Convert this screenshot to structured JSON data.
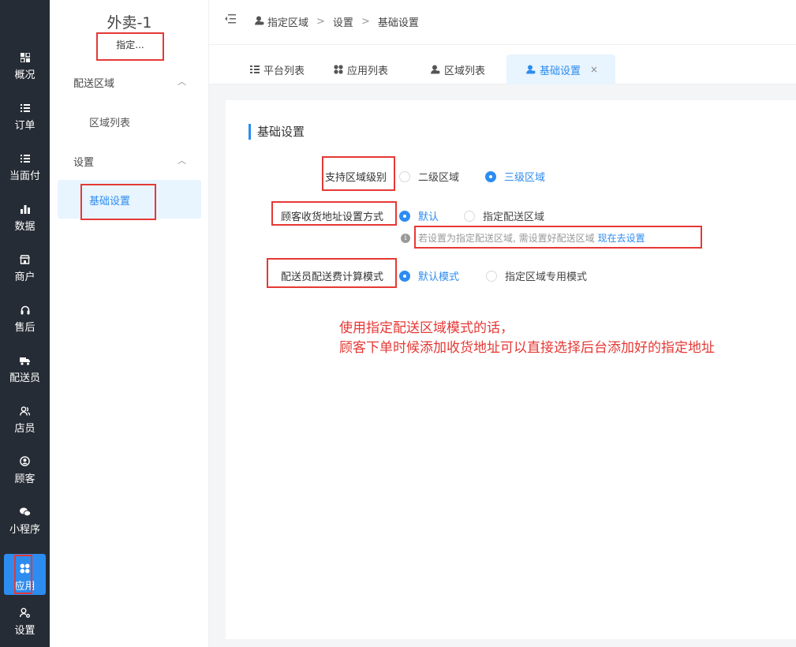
{
  "nav": {
    "items": [
      {
        "label": "概况",
        "icon": "grid-icon"
      },
      {
        "label": "订单",
        "icon": "list-icon"
      },
      {
        "label": "当面付",
        "icon": "list-icon"
      },
      {
        "label": "数据",
        "icon": "bar-chart-icon"
      },
      {
        "label": "商户",
        "icon": "store-icon"
      },
      {
        "label": "售后",
        "icon": "headset-icon"
      },
      {
        "label": "配送员",
        "icon": "truck-icon"
      },
      {
        "label": "店员",
        "icon": "staff-icon"
      },
      {
        "label": "顾客",
        "icon": "user-circle-icon"
      },
      {
        "label": "小程序",
        "icon": "wechat-icon"
      },
      {
        "label": "应用",
        "icon": "apps-icon"
      },
      {
        "label": "设置",
        "icon": "user-settings-icon"
      }
    ],
    "active_color": "#2d8cf0"
  },
  "sidebar": {
    "title": "外卖-1",
    "subtitle": "指定...",
    "group1": "配送区域",
    "group1_link": "区域列表",
    "group2": "设置",
    "group2_link": "基础设置"
  },
  "header": {
    "breadcrumb": [
      "指定区域",
      "设置",
      "基础设置"
    ],
    "separator": ">"
  },
  "tabs": [
    {
      "label": "平台列表",
      "icon": "list-icon"
    },
    {
      "label": "应用列表",
      "icon": "apps-icon"
    },
    {
      "label": "区域列表",
      "icon": "user-pin-icon"
    },
    {
      "label": "基础设置",
      "icon": "user-pin-icon",
      "close": "×"
    }
  ],
  "form": {
    "title": "基础设置",
    "row1": {
      "label": "支持区域级别",
      "options": [
        "二级区域",
        "三级区域"
      ],
      "selected": 1
    },
    "row2": {
      "label": "顾客收货地址设置方式",
      "options": [
        "默认",
        "指定配送区域"
      ],
      "selected": 0
    },
    "hint": {
      "text": "若设置为指定配送区域, 需设置好配送区域",
      "link": "现在去设置"
    },
    "row3": {
      "label": "配送员配送费计算模式",
      "options": [
        "默认模式",
        "指定区域专用模式"
      ],
      "selected": 0
    }
  },
  "note": {
    "line1": "使用指定配送区域模式的话，",
    "line2": "顾客下单时候添加收货地址可以直接选择后台添加好的指定地址",
    "color": "#e53935"
  }
}
